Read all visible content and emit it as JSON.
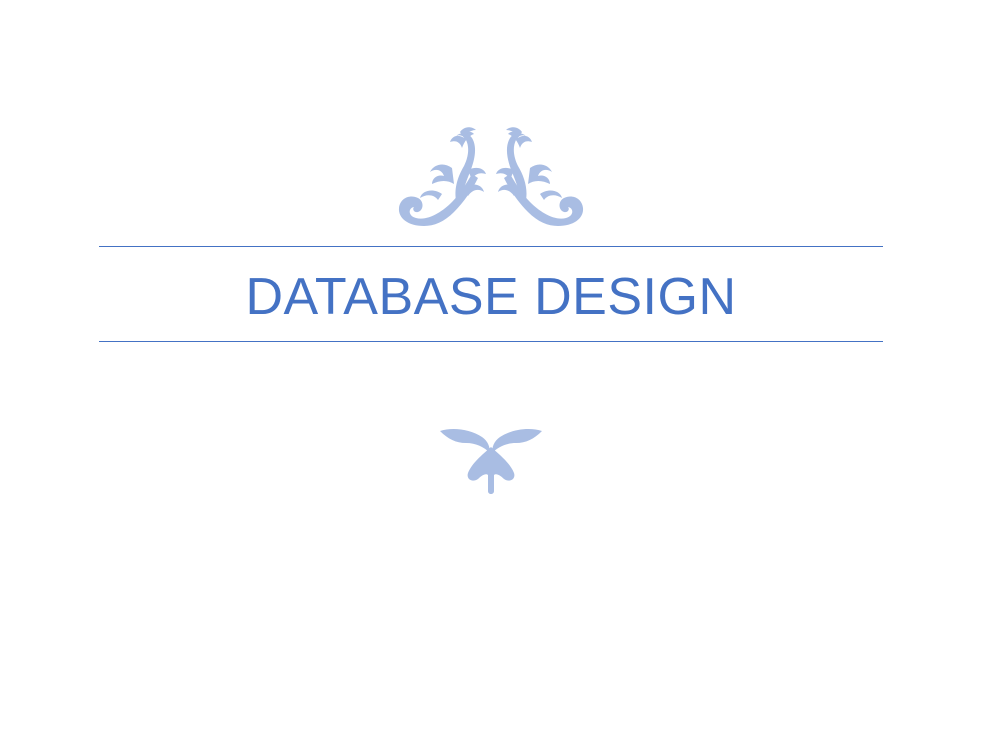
{
  "document": {
    "title": "DATABASE DESIGN"
  },
  "theme": {
    "accent_color": "#4472c4",
    "ornament_color": "#a9bde3",
    "background": "#ffffff"
  },
  "ornaments": {
    "top": "floral-scroll-pair-icon",
    "bottom": "fleur-drop-icon"
  }
}
